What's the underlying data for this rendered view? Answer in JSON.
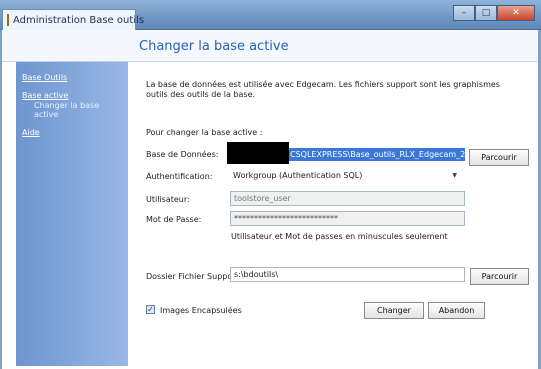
{
  "window": {
    "title": "Administration Base outils",
    "buttons": {
      "minimize": "–",
      "maximize": "□",
      "close": "✕"
    }
  },
  "header": {
    "title": "Changer la base active"
  },
  "sidebar": {
    "items": [
      {
        "label": "Base Outils"
      },
      {
        "label": "Base active"
      },
      {
        "label": "Changer la base active"
      },
      {
        "label": "Aide"
      }
    ]
  },
  "main": {
    "description": "La base de données est utilisée avec Edgecam. Les fichiers support sont les graphismes outils des outils de la base.",
    "change_prompt": "Pour changer la base active :",
    "db_label": "Base de Données:",
    "db_value": "CSQLEXPRESS\\Base_outils_RLX_Edgecam_2",
    "browse_label": "Parcourir",
    "auth_label": "Authentification:",
    "auth_value": "Workgroup (Authentication SQL)",
    "user_label": "Utilisateur:",
    "user_value": "toolstore_user",
    "password_label": "Mot de Passe:",
    "password_value": "**************************",
    "note": "Utilisateur et Mot de passes en minuscules seulement",
    "folder_label": "Dossier Fichier Suppo",
    "folder_value": "s:\\bdoutils\\",
    "browse2_label": "Parcourir",
    "images_label": "Images Encapsulées",
    "change_button": "Changer",
    "cancel_button": "Abandon"
  }
}
